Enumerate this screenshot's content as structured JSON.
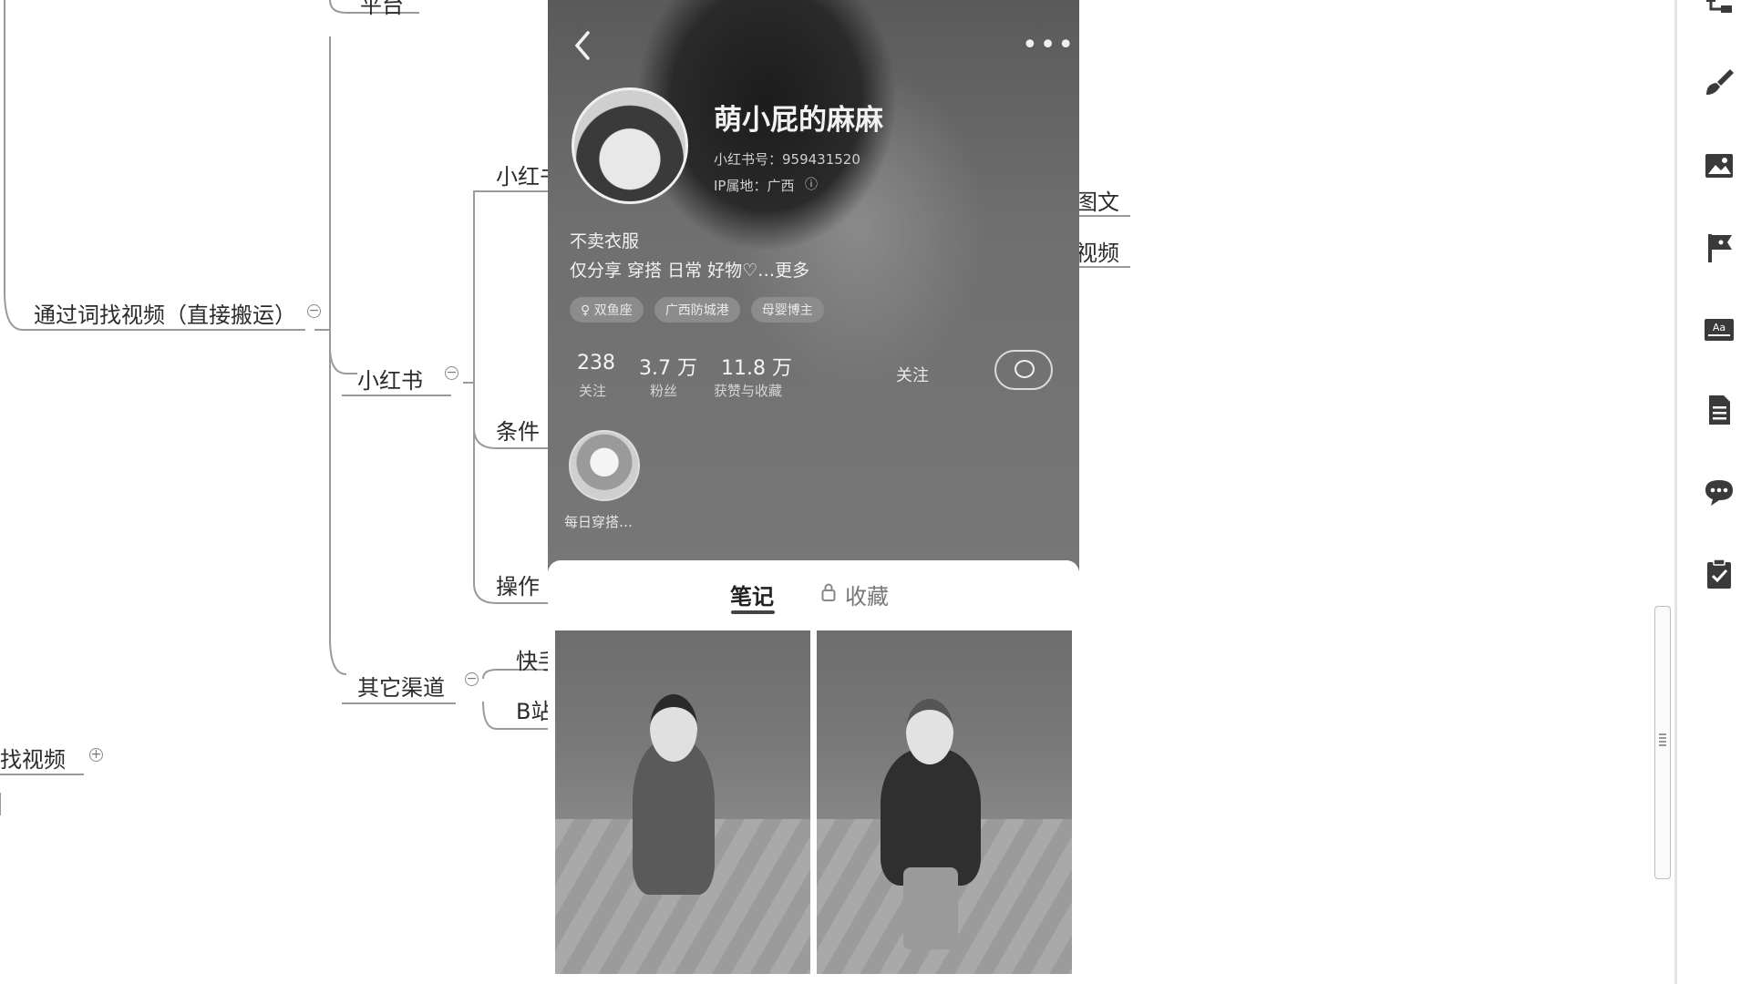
{
  "mindmap": {
    "partial_top": "平台",
    "root_branch": "通过词找视频（直接搬运）",
    "xiaohongshu": "小红书",
    "xiaohongshu_child_partial": "小红书",
    "condition": "条件",
    "operation": "操作",
    "other_channels": "其它渠道",
    "kuaishou": "快手",
    "bilibili": "B站",
    "find_video_partial": "找视频",
    "right_text_1": "图文",
    "right_text_2": "视频"
  },
  "profile": {
    "name": "萌小屁的麻麻",
    "account_id": "小红书号：959431520",
    "ip_location": "IP属地：广西",
    "bio_line1": "不卖衣服",
    "bio_line2": "仅分享 穿搭 日常 好物♡…更多",
    "tags": [
      "♀ 双鱼座",
      "广西防城港",
      "母婴博主"
    ],
    "stats": [
      {
        "value": "238",
        "label": "关注"
      },
      {
        "value": "3.7 万",
        "label": "粉丝"
      },
      {
        "value": "11.8 万",
        "label": "获赞与收藏"
      }
    ],
    "follow_label": "关注",
    "highlight_label": "每日穿搭…",
    "tabs": {
      "notes": "笔记",
      "collect": "收藏"
    }
  },
  "icons": {
    "back": "chevron-left-icon",
    "more": "more-icon",
    "message": "message-icon",
    "lock": "lock-icon"
  },
  "sidebar": {
    "icons": [
      "structure-icon",
      "brush-icon",
      "image-icon",
      "flag-icon",
      "text-icon",
      "document-icon",
      "comment-icon",
      "task-icon"
    ]
  }
}
